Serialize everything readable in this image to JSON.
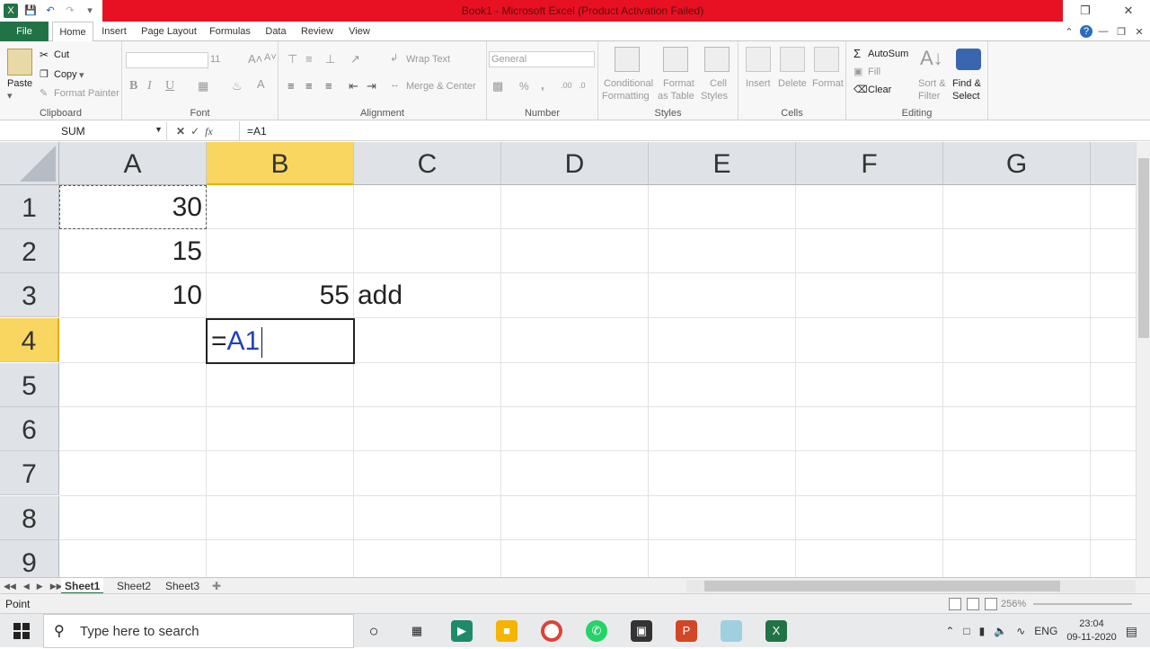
{
  "window": {
    "title": "Book1  -  Microsoft Excel (Product Activation Failed)"
  },
  "ribbon_tabs": [
    "File",
    "Home",
    "Insert",
    "Page Layout",
    "Formulas",
    "Data",
    "Review",
    "View"
  ],
  "clipboard": {
    "paste": "Paste",
    "cut": "Cut",
    "copy": "Copy",
    "format_painter": "Format Painter",
    "label": "Clipboard"
  },
  "font": {
    "size": "11",
    "bold": "B",
    "italic": "I",
    "underline": "U",
    "label": "Font"
  },
  "alignment": {
    "wrap_text": "Wrap Text",
    "merge_center": "Merge & Center",
    "label": "Alignment"
  },
  "number": {
    "format": "General",
    "percent": "%",
    "comma": ",",
    "label": "Number"
  },
  "styles": {
    "conditional_1": "Conditional",
    "conditional_2": "Formatting",
    "format_table_1": "Format",
    "format_table_2": "as Table",
    "cell_styles_1": "Cell",
    "cell_styles_2": "Styles",
    "label": "Styles"
  },
  "cells": {
    "insert": "Insert",
    "delete": "Delete",
    "format": "Format",
    "label": "Cells"
  },
  "editing": {
    "autosum": "AutoSum",
    "fill": "Fill",
    "clear": "Clear",
    "sort_1": "Sort &",
    "sort_2": "Filter",
    "find_1": "Find &",
    "find_2": "Select",
    "label": "Editing"
  },
  "formula_bar": {
    "name_box": "SUM",
    "formula": "=A1"
  },
  "grid": {
    "columns": [
      "A",
      "B",
      "C",
      "D",
      "E",
      "F",
      "G"
    ],
    "rows": [
      "1",
      "2",
      "3",
      "4",
      "5",
      "6",
      "7",
      "8",
      "9"
    ],
    "a1": "30",
    "a2": "15",
    "a3": "10",
    "b3": "55",
    "c3": "add",
    "b4_eq": "=",
    "b4_ref": "A1"
  },
  "sheets": [
    "Sheet1",
    "Sheet2",
    "Sheet3"
  ],
  "status": {
    "mode": "Point",
    "zoom": "256%"
  },
  "taskbar": {
    "search_placeholder": "Type here to search",
    "language": "ENG",
    "time": "23:04",
    "date": "09-11-2020"
  }
}
